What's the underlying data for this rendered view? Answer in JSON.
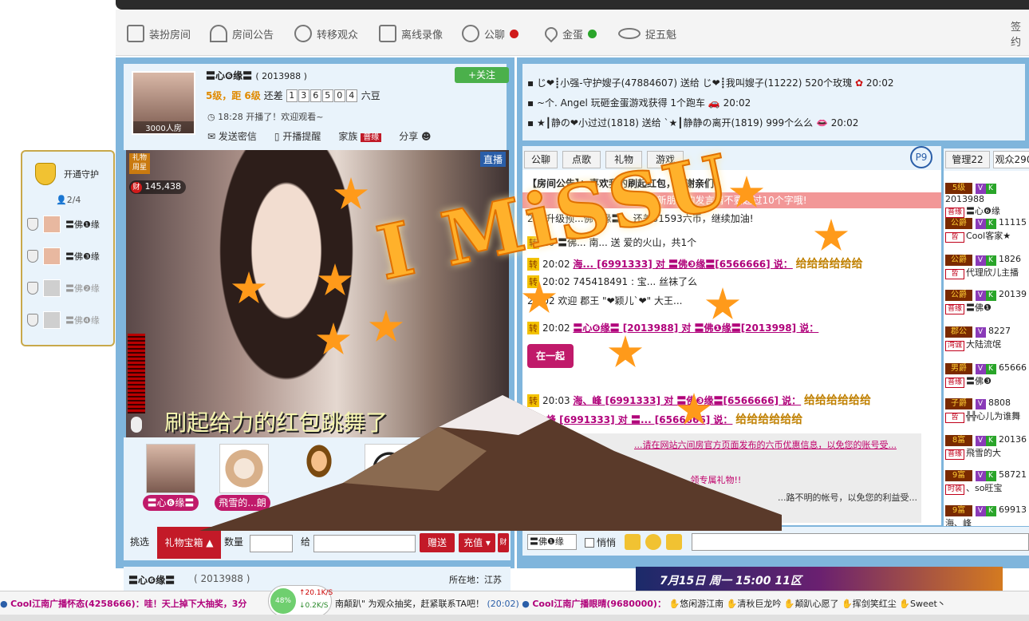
{
  "toolbar": {
    "items": [
      {
        "label": "装扮房间",
        "icon": "dressup-icon"
      },
      {
        "label": "房间公告",
        "icon": "tower-icon"
      },
      {
        "label": "转移观众",
        "icon": "link-icon"
      },
      {
        "label": "离线录像",
        "icon": "tv-icon"
      },
      {
        "label": "公聊",
        "icon": "chat-icon"
      },
      {
        "label": "金蛋",
        "icon": "location-icon"
      },
      {
        "label": "捉五魁",
        "icon": "hat-icon"
      }
    ],
    "right_text": "签约"
  },
  "guard": {
    "title": "开通守护",
    "count": "2/4",
    "members": [
      "〓佛❶缘",
      "〓佛❸缘",
      "〓佛❷缘",
      "〓佛❹缘"
    ]
  },
  "host": {
    "name": "〓心❻缘〓",
    "id": "( 2013988 )",
    "follow_label": "+关注",
    "level_text": "5级，距",
    "level_next": "6级",
    "remain_label": "还差",
    "digits": [
      "1",
      "3",
      "6",
      "5",
      "0",
      "4"
    ],
    "unit": "六豆",
    "time_text": "18:28 开播了！欢迎观看~",
    "room_label": "3000人房",
    "actions": [
      "发送密信",
      "开播提醒",
      "家族",
      "分享"
    ],
    "family_badge": "普缘"
  },
  "video": {
    "live_label": "直播",
    "gift_badge": "礼物周星",
    "wealth_value": "145,438",
    "subtitle": "刷起给力的红包跳舞了"
  },
  "gift_users": [
    {
      "name": "〓心❻缘〓"
    },
    {
      "name": "飛雪的...朗"
    },
    {
      "name": ""
    },
    {
      "name": ""
    }
  ],
  "sendbar": {
    "pick_label": "挑选",
    "box_label": "礼物宝箱",
    "qty_label": "数量",
    "to_label": "给",
    "send_label": "赠送",
    "recharge_label": "充值"
  },
  "ticker": [
    "じ❤┋小强-守护嫂子(47884607) 送给 じ❤┋我叫嫂子(11222) 520个玫瑰",
    "~个. Angel 玩砸金蛋游戏获得 1个跑车",
    "★┃静の❤小过过(1818) 送给 `★┃静静の离开(1819) 999个么么"
  ],
  "ticker_times": [
    "20:02",
    "20:02",
    "20:02"
  ],
  "chat": {
    "tabs": [
      "公聊",
      "点歌",
      "礼物",
      "游戏"
    ],
    "page_label": "P9",
    "announcement": "【房间公告】：喜欢我的刷起红包，谢谢亲们",
    "notice": "新朋友的发言请不要超过10个字哦!",
    "lines": [
      {
        "tag": "",
        "time": "20:",
        "text": "升级预...佛❸缘〓... 还差51593六币，继续加油!"
      },
      {
        "tag": "转",
        "time": "20",
        "text": "〓佛... 南... 送  爱的火山，共1个"
      },
      {
        "tag": "转",
        "time": "20:02",
        "text": "海... [6991333] 对 〓佛❸缘〓[6566666] 说："
      },
      {
        "tag": "转",
        "time": "20:02",
        "text": "745418491 : 宝... 丝袜了么"
      },
      {
        "tag": "",
        "time": "20:02",
        "text": "欢迎  郡王  \"❤颖儿`❤\" 大王..."
      },
      {
        "tag": "转",
        "time": "20:02",
        "text": "〓心❻缘〓 [2013988] 对 〓佛❶缘〓[2013998] 说："
      },
      {
        "tag": "转",
        "time": "20:03",
        "text": "海、峰 [6991333] 对 〓佛❸缘〓[6566666] 说："
      },
      {
        "tag": "",
        "time": "",
        "text": "海、峰 [6991333] 对 〓... [6566666] 说："
      }
    ],
    "gold_text": "给给给给给给",
    "sign_text": "在一起",
    "tips": [
      "...请在网站六间房官方页面发布的六币优惠信息，以免您的账号受...",
      "...领专属礼物!!",
      "...路不明的帐号，以免您的利益受..."
    ]
  },
  "userlist": {
    "tabs": [
      "管理22",
      "观众290"
    ],
    "users": [
      {
        "badge": "5级",
        "tag": "普缘",
        "name": "〓心❻缘",
        "id": "2013988"
      },
      {
        "badge": "公爵",
        "tag": "皆",
        "name": "Cool客家★",
        "id": "11115"
      },
      {
        "badge": "公爵",
        "tag": "皆",
        "name": "代理欣儿主播",
        "id": "1826"
      },
      {
        "badge": "公爵",
        "tag": "普缘",
        "name": "〓佛❶",
        "id": "20139"
      },
      {
        "badge": "郡公",
        "tag": "湾诚",
        "name": "大陆流氓",
        "id": "8227"
      },
      {
        "badge": "男爵",
        "tag": "普缘",
        "name": "〓佛❸",
        "id": "65666"
      },
      {
        "badge": "子爵",
        "tag": "皆",
        "name": "╬╬心儿为谁舞",
        "id": "8808"
      },
      {
        "badge": "8富",
        "tag": "普缘",
        "name": "飛雪的大",
        "id": "20136"
      },
      {
        "badge": "9富",
        "tag": "时装",
        "name": "、so旺宝",
        "id": "58721"
      },
      {
        "badge": "9富",
        "tag": "",
        "name": "海、峰",
        "id": "69913"
      }
    ]
  },
  "chatinput": {
    "target": "〓佛❶缘",
    "whisper_label": "悄悄"
  },
  "host_bottom": {
    "name": "〓心❻缘〓",
    "id": "( 2013988 )",
    "location": "所在地：江苏"
  },
  "banner_text": "7月15日 周一 15:00 11区",
  "speed": {
    "percent": "48%",
    "up": "20.1K/S",
    "down": "0.2K/S"
  },
  "bottom_ticker": [
    "Cool江南广播怀态(4258666)：哇！天上掉下大抽奖，3分",
    "南颠趴\" 为观众抽奖，赶紧联系TA吧！",
    "(20:02)",
    "Cool江南广播眼晴(9680000)：",
    "悠闲游江南",
    "清秋巨龙吟",
    "颠趴心愿了",
    "挥剑笑红尘",
    "Sweet丶"
  ],
  "overlay_text": "I MiSSU",
  "colors": {
    "panel_blue": "#7fb5dc",
    "accent_red": "#c31a28",
    "vip_pink": "#c01a6a",
    "gold": "#ffb12b"
  }
}
